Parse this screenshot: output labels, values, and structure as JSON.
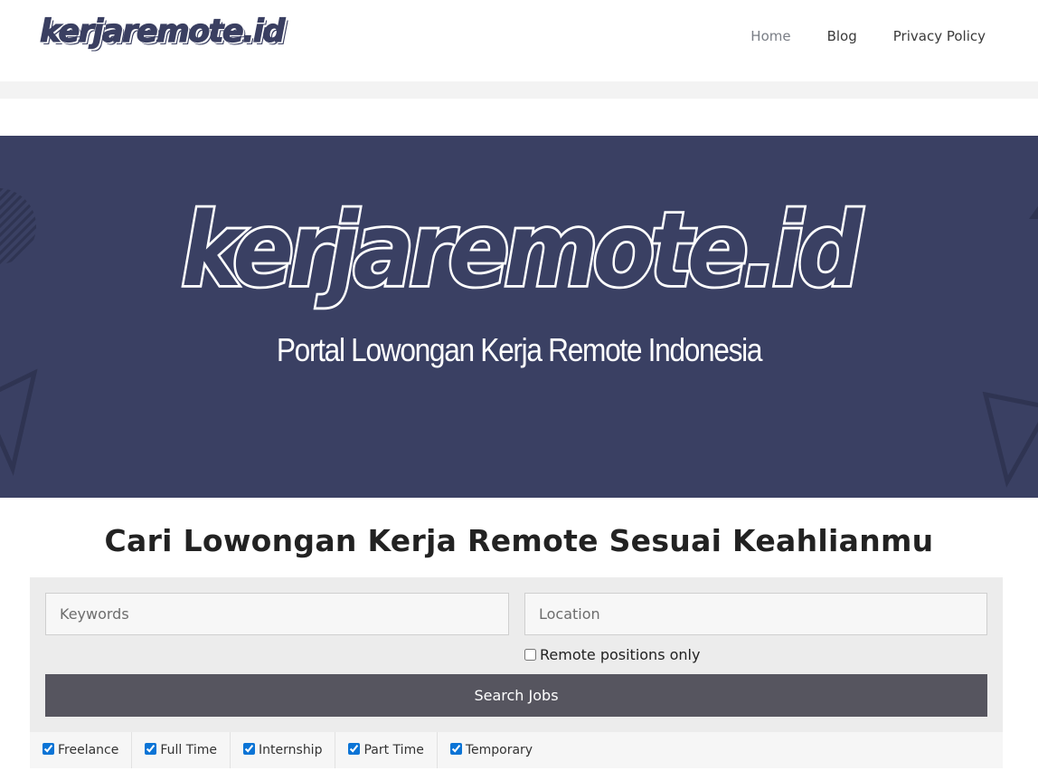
{
  "header": {
    "logo_text": "kerjaremote.id",
    "nav": [
      {
        "label": "Home",
        "active": true
      },
      {
        "label": "Blog",
        "active": false
      },
      {
        "label": "Privacy Policy",
        "active": false
      }
    ]
  },
  "banner": {
    "title": "kerjaremote.id",
    "subtitle": "Portal Lowongan Kerja Remote Indonesia",
    "background_color": "#3a4063"
  },
  "search": {
    "heading": "Cari Lowongan Kerja Remote Sesuai Keahlianmu",
    "keywords_placeholder": "Keywords",
    "location_placeholder": "Location",
    "remote_only_label": "Remote positions only",
    "remote_only_checked": false,
    "button_label": "Search Jobs",
    "button_color": "#56555f"
  },
  "job_types": [
    {
      "label": "Freelance",
      "checked": true
    },
    {
      "label": "Full Time",
      "checked": true
    },
    {
      "label": "Internship",
      "checked": true
    },
    {
      "label": "Part Time",
      "checked": true
    },
    {
      "label": "Temporary",
      "checked": true
    }
  ]
}
